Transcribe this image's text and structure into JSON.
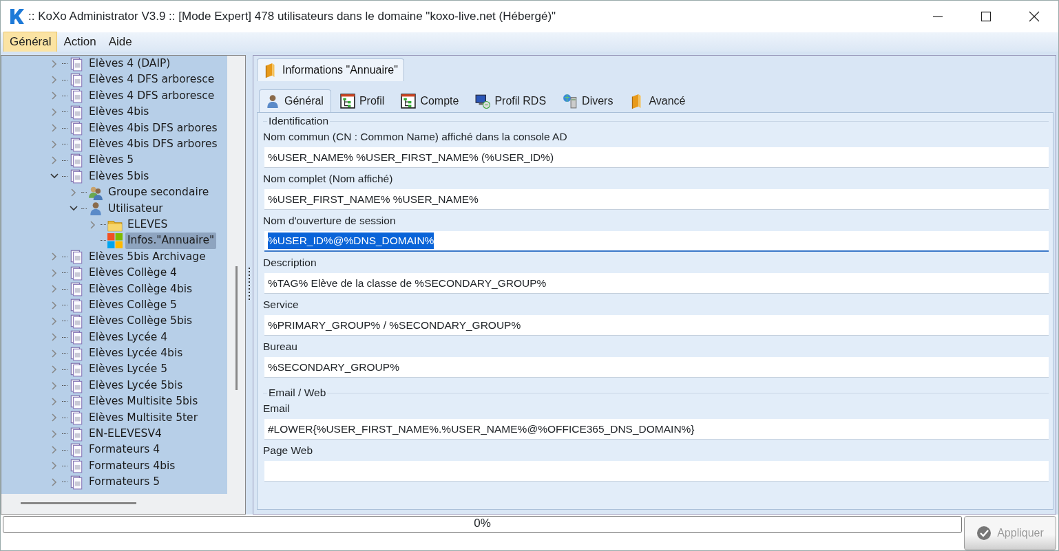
{
  "window": {
    "title": ":: KoXo Administrator V3.9 :: [Mode Expert] 478 utilisateurs dans le domaine \"koxo-live.net (Hébergé)\""
  },
  "menu": [
    {
      "label": "Général",
      "selected": true
    },
    {
      "label": "Action",
      "selected": false
    },
    {
      "label": "Aide",
      "selected": false
    }
  ],
  "tree": [
    {
      "label": "Elèves 4 (DAIP)",
      "kind": "document",
      "expanded": false,
      "selected": false
    },
    {
      "label": "Elèves 4 DFS arboresce",
      "kind": "document",
      "expanded": false,
      "selected": false
    },
    {
      "label": "Elèves 4 DFS arboresce",
      "kind": "document",
      "expanded": false,
      "selected": false
    },
    {
      "label": "Elèves 4bis",
      "kind": "document",
      "expanded": false,
      "selected": false
    },
    {
      "label": "Elèves 4bis DFS arbores",
      "kind": "document",
      "expanded": false,
      "selected": false
    },
    {
      "label": "Elèves 4bis DFS arbores",
      "kind": "document",
      "expanded": false,
      "selected": false
    },
    {
      "label": "Elèves 5",
      "kind": "document",
      "expanded": false,
      "selected": false
    },
    {
      "label": "Elèves 5bis",
      "kind": "document",
      "expanded": true,
      "selected": false,
      "children": [
        {
          "label": "Groupe secondaire",
          "kind": "group",
          "expanded": false,
          "selected": false
        },
        {
          "label": "Utilisateur",
          "kind": "user",
          "expanded": true,
          "selected": false,
          "children": [
            {
              "label": "ELEVES",
              "kind": "folder",
              "expanded": false,
              "selected": false
            },
            {
              "label": "Infos.\"Annuaire\"",
              "kind": "windows",
              "selected": true
            }
          ]
        }
      ]
    },
    {
      "label": "Elèves 5bis Archivage",
      "kind": "document",
      "expanded": false,
      "selected": false
    },
    {
      "label": "Elèves Collège 4",
      "kind": "document",
      "expanded": false,
      "selected": false
    },
    {
      "label": "Elèves Collège 4bis",
      "kind": "document",
      "expanded": false,
      "selected": false
    },
    {
      "label": "Elèves Collège 5",
      "kind": "document",
      "expanded": false,
      "selected": false
    },
    {
      "label": "Elèves Collège 5bis",
      "kind": "document",
      "expanded": false,
      "selected": false
    },
    {
      "label": "Elèves Lycée 4",
      "kind": "document",
      "expanded": false,
      "selected": false
    },
    {
      "label": "Elèves Lycée 4bis",
      "kind": "document",
      "expanded": false,
      "selected": false
    },
    {
      "label": "Elèves Lycée 5",
      "kind": "document",
      "expanded": false,
      "selected": false
    },
    {
      "label": "Elèves Lycée 5bis",
      "kind": "document",
      "expanded": false,
      "selected": false
    },
    {
      "label": "Elèves Multisite 5bis",
      "kind": "document",
      "expanded": false,
      "selected": false
    },
    {
      "label": "Elèves Multisite 5ter",
      "kind": "document",
      "expanded": false,
      "selected": false
    },
    {
      "label": "EN-ELEVESV4",
      "kind": "document",
      "expanded": false,
      "selected": false
    },
    {
      "label": "Formateurs 4",
      "kind": "document",
      "expanded": false,
      "selected": false
    },
    {
      "label": "Formateurs 4bis",
      "kind": "document",
      "expanded": false,
      "selected": false
    },
    {
      "label": "Formateurs 5",
      "kind": "document",
      "expanded": false,
      "selected": false
    }
  ],
  "outer_tabs": [
    {
      "label": "Informations \"Annuaire\"",
      "kind": "book",
      "selected": true
    }
  ],
  "tabs": [
    {
      "label": "Général",
      "kind": "user",
      "selected": true
    },
    {
      "label": "Profil",
      "kind": "hierarchy",
      "selected": false
    },
    {
      "label": "Compte",
      "kind": "hierarchy",
      "selected": false
    },
    {
      "label": "Profil RDS",
      "kind": "monitor",
      "selected": false
    },
    {
      "label": "Divers",
      "kind": "globe",
      "selected": false
    },
    {
      "label": "Avancé",
      "kind": "book",
      "selected": false
    }
  ],
  "sections": [
    {
      "title": "Identification",
      "fields": [
        {
          "label": "Nom commun (CN : Common Name) affiché dans la console AD",
          "value": "%USER_NAME% %USER_FIRST_NAME% (%USER_ID%)",
          "focused": false
        },
        {
          "label": "Nom complet (Nom affiché)",
          "value": "%USER_FIRST_NAME% %USER_NAME%",
          "focused": false
        },
        {
          "label": "Nom d'ouverture de session",
          "value": "%USER_ID%@%DNS_DOMAIN%",
          "focused": true
        },
        {
          "label": "Description",
          "value": "%TAG% Elève de la classe de %SECONDARY_GROUP%",
          "focused": false
        },
        {
          "label": "Service",
          "value": "%PRIMARY_GROUP% / %SECONDARY_GROUP%",
          "focused": false
        },
        {
          "label": "Bureau",
          "value": "%SECONDARY_GROUP%",
          "focused": false
        }
      ]
    },
    {
      "title": "Email / Web",
      "fields": [
        {
          "label": "Email",
          "value": "#LOWER{%USER_FIRST_NAME%.%USER_NAME%@%OFFICE365_DNS_DOMAIN%}",
          "focused": false
        },
        {
          "label": "Page Web",
          "focused": false
        }
      ]
    }
  ],
  "progress": {
    "label": "0%",
    "level": 0
  },
  "apply_button": {
    "label": "Appliquer",
    "disabled": true
  }
}
